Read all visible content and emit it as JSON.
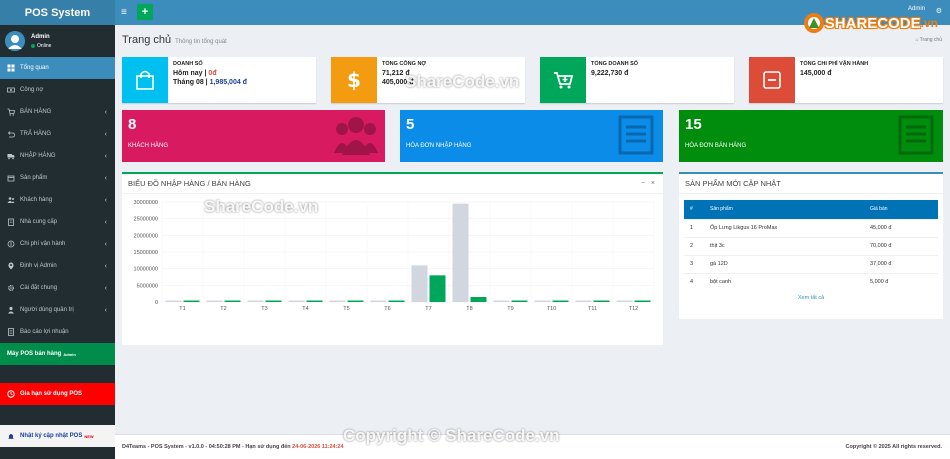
{
  "app": {
    "title": "POS System"
  },
  "user": {
    "name": "Admin",
    "status": "Online"
  },
  "top": {
    "user": "Admin"
  },
  "brand": {
    "name": "SHARECODE",
    "domain": ".vn"
  },
  "sidebar": {
    "items": [
      {
        "label": "Tổng quan",
        "icon": "dashboard-icon"
      },
      {
        "label": "Công nợ",
        "icon": "money-icon"
      },
      {
        "label": "BÁN HÀNG",
        "icon": "cart-icon"
      },
      {
        "label": "TRẢ HÀNG",
        "icon": "return-icon"
      },
      {
        "label": "NHẬP HÀNG",
        "icon": "truck-icon"
      },
      {
        "label": "Sản phẩm",
        "icon": "box-icon"
      },
      {
        "label": "Khách hàng",
        "icon": "users-icon"
      },
      {
        "label": "Nhà cung cấp",
        "icon": "building-icon"
      },
      {
        "label": "Chi phí vận hành",
        "icon": "coin-icon"
      },
      {
        "label": "Định vị Admin",
        "icon": "map-pin-icon"
      },
      {
        "label": "Cài đặt chung",
        "icon": "gear-icon"
      },
      {
        "label": "Người dùng quản trị",
        "icon": "user-admin-icon"
      },
      {
        "label": "Báo cáo lợi nhuận",
        "icon": "report-icon"
      }
    ],
    "pos_machine": "Máy POS bán hàng",
    "pos_machine_sup": "Admin",
    "expiry": "Gia hạn sử dụng POS",
    "update_log": "Nhật ký cập nhật POS",
    "update_log_sup": "NEW"
  },
  "header": {
    "title": "Trang chủ",
    "subtitle": "Thông tin tổng quát",
    "breadcrumb": "Trang chủ"
  },
  "info_boxes": [
    {
      "title": "DOANH SỐ",
      "line1_label": "Hôm nay",
      "line1_value": "0đ",
      "line2_label": "Tháng 08",
      "line2_value": "1,985,004 đ",
      "color": "#00c0ef"
    },
    {
      "title": "TỔNG CÔNG NỢ",
      "line1": "71,212 đ",
      "line2": "405,000 đ",
      "color": "#f39c12"
    },
    {
      "title": "TỔNG DOANH SỐ",
      "line1": "9,222,730 đ",
      "color": "#00a65a"
    },
    {
      "title": "TỔNG CHI PHÍ VẬN HÀNH",
      "line1": "145,000 đ",
      "color": "#dd4b39"
    }
  ],
  "small_boxes": [
    {
      "number": "8",
      "label": "KHÁCH HÀNG",
      "color": "#d81b60"
    },
    {
      "number": "5",
      "label": "HÓA ĐƠN NHẬP HÀNG",
      "color": "#0c8ce9"
    },
    {
      "number": "15",
      "label": "HÓA ĐƠN BÁN HÀNG",
      "color": "#008d0e"
    }
  ],
  "chart_panel": {
    "title": "BIỂU ĐỒ NHẬP HÀNG / BÁN HÀNG"
  },
  "chart_data": {
    "type": "bar",
    "categories": [
      "T1",
      "T2",
      "T3",
      "T4",
      "T5",
      "T6",
      "T7",
      "T8",
      "T9",
      "T10",
      "T11",
      "T12"
    ],
    "series": [
      {
        "values": [
          0,
          0,
          0,
          0,
          0,
          0,
          11000000,
          29500000,
          0,
          0,
          0,
          0
        ],
        "color": "#d2d6de"
      },
      {
        "values": [
          0,
          0,
          0,
          0,
          0,
          0,
          8000000,
          1500000,
          0,
          0,
          0,
          0
        ],
        "color": "#00a65a"
      }
    ],
    "yticks": [
      "30000000",
      "25000000",
      "20000000",
      "15000000",
      "10000000",
      "5000000",
      "0"
    ],
    "ylim": [
      0,
      30000000
    ]
  },
  "products_panel": {
    "title": "SẢN PHẨM MỚI CẬP NHẬT",
    "columns": [
      "#",
      "Sản phẩm",
      "Giá bán"
    ],
    "rows": [
      [
        "1",
        "Ốp Lưng Likgus 16 ProMax",
        "45,000 đ"
      ],
      [
        "2",
        "thịt 3c",
        "70,000 đ"
      ],
      [
        "3",
        "gà 12D",
        "37,000 đ"
      ],
      [
        "4",
        "bột canh",
        "5,000 đ"
      ]
    ],
    "see_all": "Xem tất cả"
  },
  "footer": {
    "left": "D4Teams - POS System - v1.0.0 - 04:50:28 PM - Hạn sử dụng đến",
    "expiry": "24-06-2026 11:24:24",
    "right": "Copyright © 2025 All rights reserved."
  },
  "watermarks": {
    "text1": "ShareCode.vn",
    "text2": "Copyright © ShareCode.vn"
  }
}
